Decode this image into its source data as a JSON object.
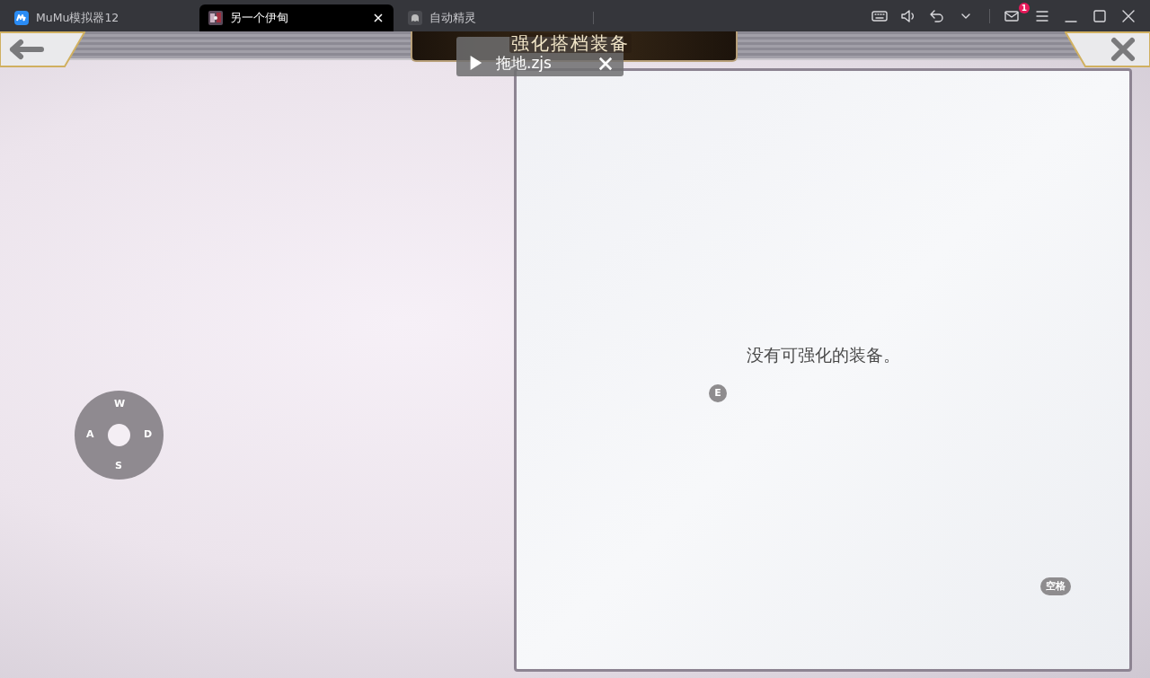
{
  "tabs": [
    {
      "label": "MuMu模拟器12",
      "selected": false,
      "kind": "app"
    },
    {
      "label": "另一个伊甸",
      "selected": true,
      "kind": "game"
    },
    {
      "label": "自动精灵",
      "selected": false,
      "kind": "tool"
    }
  ],
  "toolbar": {
    "mail_badge": "1"
  },
  "game": {
    "title": "强化搭档装备",
    "message": "没有可强化的装备。"
  },
  "keymap": {
    "joystick": {
      "up": "W",
      "left": "A",
      "right": "D",
      "down": "S"
    },
    "keys": [
      {
        "label": "E"
      },
      {
        "label": "空格"
      }
    ]
  },
  "script_bar": {
    "name": "拖地.zjs"
  }
}
